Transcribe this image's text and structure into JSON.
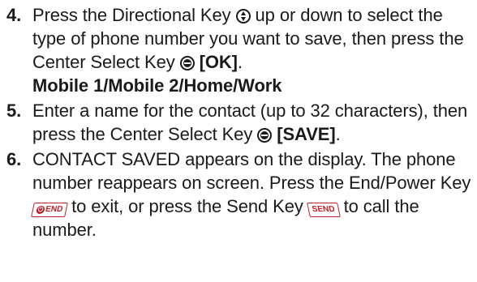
{
  "steps": [
    {
      "number": "4.",
      "parts": {
        "a": "Press the Directional Key",
        "b": "up or down to select the type of phone number you want to save, then press the Center Select Key",
        "c": "[OK]",
        "d": ".",
        "e": "Mobile 1/Mobile 2/Home/Work"
      },
      "icons": [
        "directional-key-icon",
        "center-select-key-icon"
      ]
    },
    {
      "number": "5.",
      "parts": {
        "a": "Enter a name for the contact (up to 32 characters), then press the Center Select Key",
        "b": "[SAVE]",
        "c": "."
      },
      "icons": [
        "center-select-key-icon"
      ]
    },
    {
      "number": "6.",
      "parts": {
        "a": "CONTACT SAVED appears on the display. The phone number reappears on screen. Press the End/Power Key",
        "b": "to exit, or press the Send Key",
        "c": "to call the number."
      },
      "keys": {
        "end_label": "END",
        "send_label": "SEND"
      },
      "icons": [
        "end-power-key-icon",
        "send-key-icon"
      ]
    }
  ],
  "colors": {
    "text": "#1a1a1a",
    "key_accent": "#c0202a"
  }
}
